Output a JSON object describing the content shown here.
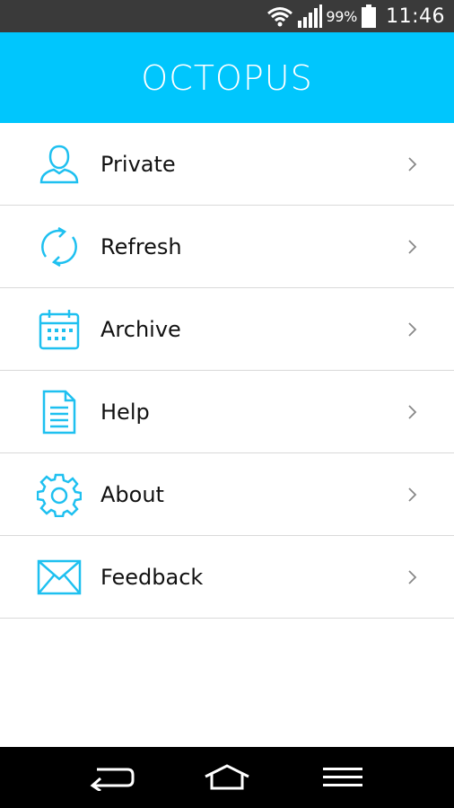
{
  "status_bar": {
    "battery_percent": "99%",
    "time": "11:46",
    "icons": [
      "wifi-icon",
      "signal-icon",
      "battery-icon"
    ]
  },
  "app_bar": {
    "title": "OCTOPUS",
    "background": "#00c6fd"
  },
  "menu": {
    "accent_color": "#1ec0f0",
    "items": [
      {
        "label": "Private",
        "icon": "user-icon"
      },
      {
        "label": "Refresh",
        "icon": "refresh-icon"
      },
      {
        "label": "Archive",
        "icon": "calendar-icon"
      },
      {
        "label": "Help",
        "icon": "document-icon"
      },
      {
        "label": "About",
        "icon": "gear-icon"
      },
      {
        "label": "Feedback",
        "icon": "envelope-icon"
      }
    ]
  },
  "nav_bar": {
    "buttons": [
      "back-icon",
      "home-icon",
      "menu-icon"
    ]
  }
}
